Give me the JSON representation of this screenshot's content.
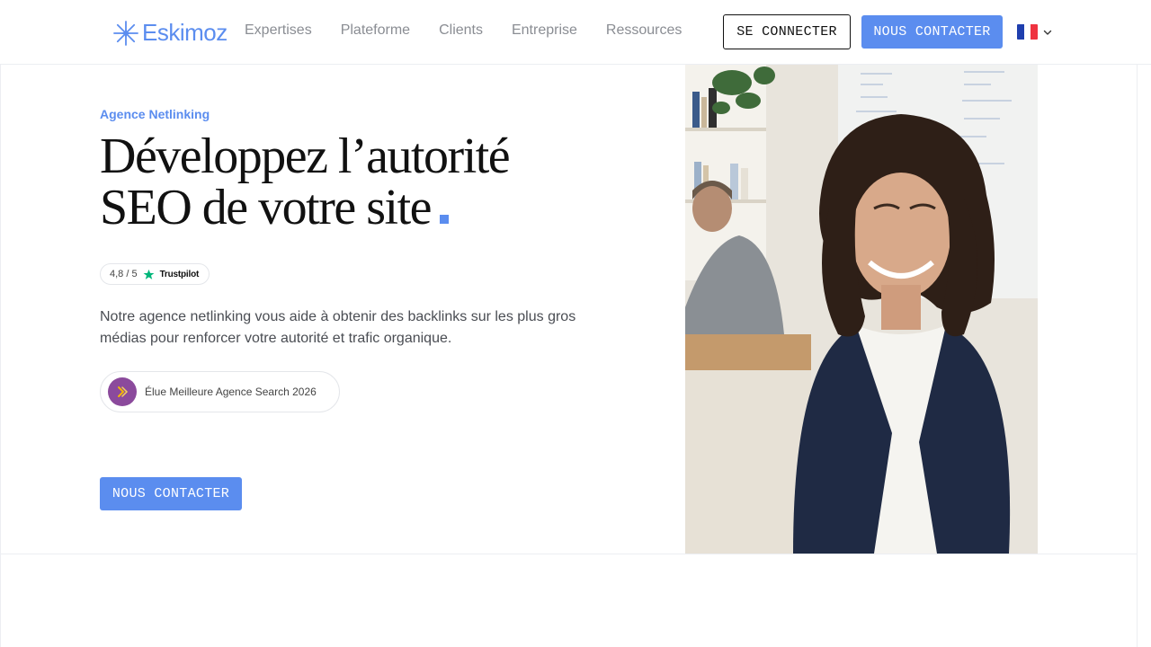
{
  "header": {
    "logo_text": "Eskimoz",
    "logo_icon": "snowflake-icon",
    "nav": [
      {
        "label": "Expertises"
      },
      {
        "label": "Plateforme"
      },
      {
        "label": "Clients"
      },
      {
        "label": "Entreprise"
      },
      {
        "label": "Ressources"
      }
    ],
    "login_label": "SE CONNECTER",
    "contact_label": "NOUS CONTACTER",
    "language_flag": "france-flag-icon"
  },
  "hero": {
    "eyebrow": "Agence Netlinking",
    "headline_line1": "Développez l’autorité",
    "headline_line2": "SEO de votre site",
    "trustpilot": {
      "rating": "4,8 / 5",
      "brand": "Trustpilot"
    },
    "description": "Notre agence netlinking vous aide à obtenir des backlinks sur les plus gros médias pour renforcer votre autorité et trafic organique.",
    "award_text": "Élue Meilleure Agence Search 2026",
    "cta_label": "NOUS CONTACTER"
  },
  "colors": {
    "accent": "#5b8def",
    "text_dark": "#111111",
    "nav_gray": "#8a8d93",
    "trustpilot_green": "#00b67a",
    "award_purple": "#8b4a9c"
  }
}
